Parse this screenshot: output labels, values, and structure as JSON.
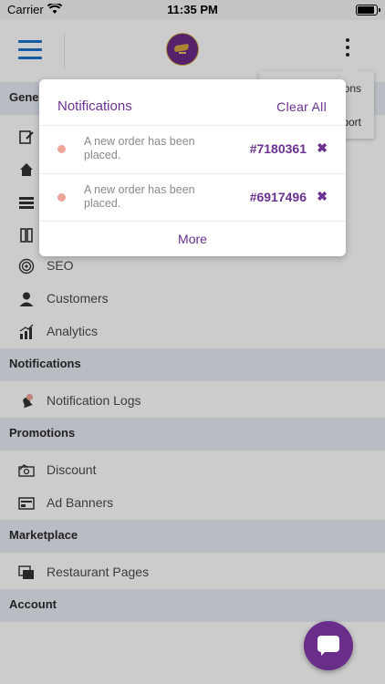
{
  "status_bar": {
    "carrier": "Carrier",
    "time": "11:35 PM"
  },
  "dropdown": {
    "items": [
      "ons",
      "port"
    ]
  },
  "menu": {
    "general_section": "Gene",
    "items_general": [
      "SEO",
      "Customers",
      "Analytics"
    ],
    "sections": [
      "Notifications",
      "Promotions",
      "Marketplace",
      "Account"
    ],
    "notification_items": [
      "Notification Logs"
    ],
    "promotion_items": [
      "Discount",
      "Ad Banners"
    ],
    "marketplace_items": [
      "Restaurant Pages"
    ]
  },
  "notifications_popup": {
    "title": "Notifications",
    "clear_all": "Clear All",
    "items": [
      {
        "message": "A new order has been placed.",
        "order_id": "#7180361"
      },
      {
        "message": "A new order has been placed.",
        "order_id": "#6917496"
      }
    ],
    "more": "More"
  },
  "colors": {
    "accent": "#6a3190",
    "hamburger": "#1a73c8",
    "section_bg": "#e6edf5",
    "unread_dot": "#f0a59a"
  },
  "icons": {
    "menu": "hamburger-icon",
    "more": "kebab-icon",
    "close": "close-icon",
    "chat": "chat-icon"
  }
}
